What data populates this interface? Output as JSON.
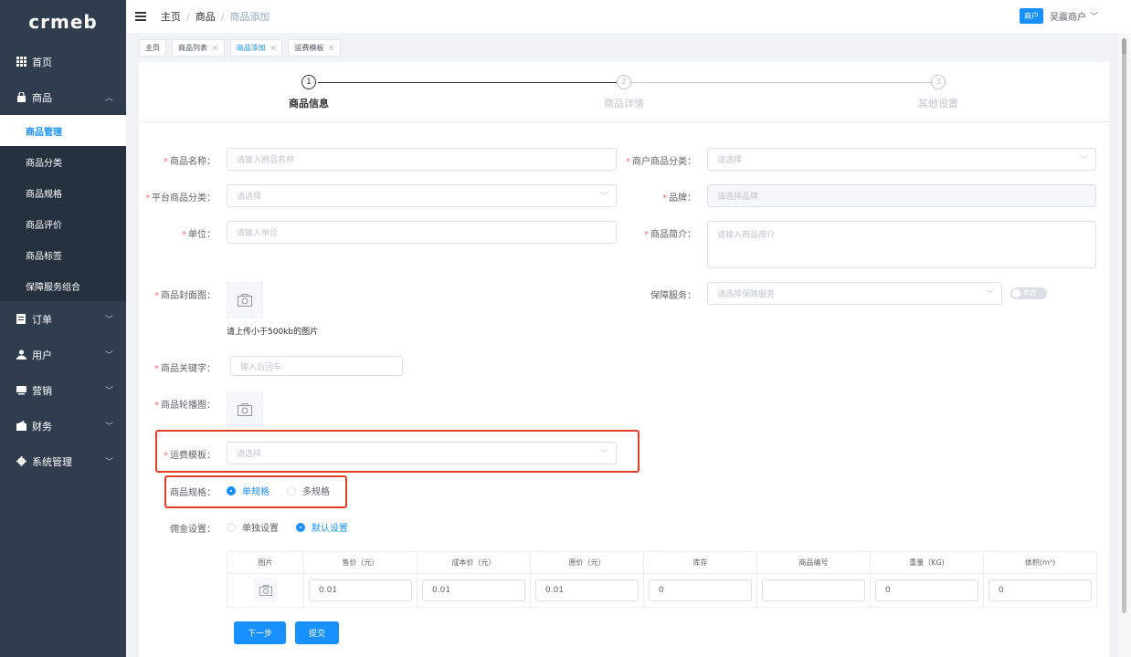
{
  "app": {
    "logo": "crmeb"
  },
  "sidebar": {
    "items": [
      {
        "label": "首页",
        "icon": "grid-icon"
      },
      {
        "label": "商品",
        "icon": "bag-icon",
        "expanded": true
      },
      {
        "label": "订单",
        "icon": "doc-icon"
      },
      {
        "label": "用户",
        "icon": "user-icon"
      },
      {
        "label": "营销",
        "icon": "screen-icon"
      },
      {
        "label": "财务",
        "icon": "wallet-icon"
      },
      {
        "label": "系统管理",
        "icon": "gear-icon"
      }
    ],
    "subitems": [
      "商品管理",
      "商品分类",
      "商品规格",
      "商品评价",
      "商品标签",
      "保障服务组合"
    ]
  },
  "header": {
    "breadcrumbs": [
      "主页",
      "商品",
      "商品添加"
    ],
    "badge": "商户",
    "merchant": "吴震商户"
  },
  "tabs": [
    "主页",
    "商品列表",
    "商品添加",
    "运费模板"
  ],
  "steps": [
    {
      "num": "1",
      "label": "商品信息"
    },
    {
      "num": "2",
      "label": "商品详情"
    },
    {
      "num": "3",
      "label": "其他设置"
    }
  ],
  "form": {
    "name": {
      "label": "商品名称：",
      "placeholder": "请输入商品名称"
    },
    "merchant_category": {
      "label": "商户商品分类：",
      "placeholder": "请选择"
    },
    "platform_category": {
      "label": "平台商品分类：",
      "placeholder": "请选择"
    },
    "brand": {
      "label": "品牌：",
      "placeholder": "请选择品牌"
    },
    "unit": {
      "label": "单位：",
      "placeholder": "请输入单位"
    },
    "intro": {
      "label": "商品简介：",
      "placeholder": "请输入商品简介"
    },
    "cover": {
      "label": "商品封面图：",
      "hint": "请上传小于500kb的图片"
    },
    "guarantee": {
      "label": "保障服务：",
      "placeholder": "请选择保障服务",
      "switch_text": "单选"
    },
    "keywords": {
      "label": "商品关键字：",
      "placeholder": "输入后回车"
    },
    "carousel": {
      "label": "商品轮播图："
    },
    "shipping": {
      "label": "运费模板：",
      "placeholder": "请选择"
    },
    "spec": {
      "label": "商品规格：",
      "options": [
        "单规格",
        "多规格"
      ],
      "selected": "单规格"
    },
    "commission": {
      "label": "佣金设置：",
      "options": [
        "单独设置",
        "默认设置"
      ],
      "selected": "默认设置"
    }
  },
  "table": {
    "headers": [
      "图片",
      "售价（元）",
      "成本价（元）",
      "原价（元）",
      "库存",
      "商品编号",
      "重量（KG)",
      "体积(m³)"
    ],
    "row": [
      "",
      "0.01",
      "0.01",
      "0.01",
      "0",
      "",
      "0",
      "0"
    ]
  },
  "buttons": {
    "next": "下一步",
    "submit": "提交"
  }
}
